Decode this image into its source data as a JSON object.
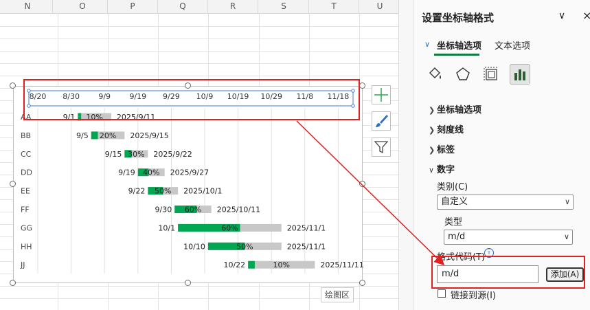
{
  "sheet": {
    "columns": [
      "N",
      "O",
      "P",
      "Q",
      "R",
      "S",
      "T",
      "U"
    ]
  },
  "chart": {
    "tooltip": "绘图区",
    "highlight_color": "#e02020",
    "progress_color": "#00a651",
    "remain_color": "#c8c8c8"
  },
  "chart_data": {
    "type": "bar",
    "subtype": "gantt",
    "x_axis": {
      "tick_labels": [
        "8/20",
        "8/30",
        "9/9",
        "9/19",
        "9/29",
        "10/9",
        "10/19",
        "10/29",
        "11/8",
        "11/18"
      ],
      "min": "2025/8/20",
      "max": "2025/11/18",
      "number_format": "m/d",
      "position": "top"
    },
    "categories": [
      "AA",
      "BB",
      "CC",
      "DD",
      "EE",
      "FF",
      "GG",
      "HH",
      "JJ"
    ],
    "tasks": [
      {
        "name": "AA",
        "start": "9/1",
        "end": "2025/9/11",
        "progress": "10%"
      },
      {
        "name": "BB",
        "start": "9/5",
        "end": "2025/9/15",
        "progress": "20%"
      },
      {
        "name": "CC",
        "start": "9/15",
        "end": "2025/9/22",
        "progress": "30%"
      },
      {
        "name": "DD",
        "start": "9/19",
        "end": "2025/9/27",
        "progress": "40%"
      },
      {
        "name": "EE",
        "start": "9/22",
        "end": "2025/10/1",
        "progress": "50%"
      },
      {
        "name": "FF",
        "start": "9/30",
        "end": "2025/10/11",
        "progress": "60%"
      },
      {
        "name": "GG",
        "start": "10/1",
        "end": "2025/11/1",
        "progress": "60%"
      },
      {
        "name": "HH",
        "start": "10/10",
        "end": "2025/11/1",
        "progress": "50%"
      },
      {
        "name": "JJ",
        "start": "10/22",
        "end": "2025/11/11",
        "progress": "10%"
      }
    ],
    "grid": true,
    "legend": "none"
  },
  "panel": {
    "title": "设置坐标轴格式",
    "tab_axis_options": "坐标轴选项",
    "tab_text_options": "文本选项",
    "sections": {
      "axis_options": "坐标轴选项",
      "tick_marks": "刻度线",
      "labels": "标签",
      "number": "数字"
    },
    "category_label": "类别(C)",
    "category_value": "自定义",
    "type_label": "类型",
    "type_value": "m/d",
    "format_code_label": "格式代码(T)",
    "format_code_value": "m/d",
    "add_button": "添加(A)",
    "link_to_source": "链接到源(I)",
    "icons": [
      "fill-line-icon",
      "effects-icon",
      "size-properties-icon",
      "axis-options-icon"
    ]
  }
}
